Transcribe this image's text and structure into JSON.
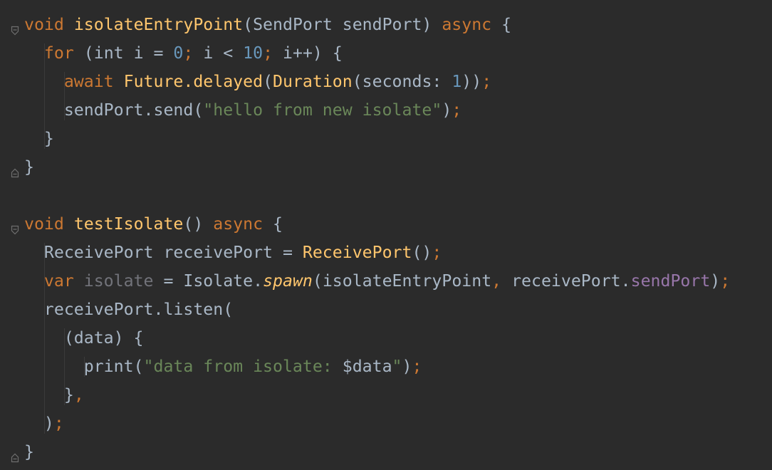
{
  "editor": {
    "theme_colors": {
      "background": "#2b2b2b",
      "default_text": "#a9b7c6",
      "keyword": "#cc7832",
      "function": "#ffc66d",
      "number": "#6897bb",
      "string": "#6a8759",
      "field": "#9876aa",
      "unused": "#72737a"
    },
    "lines": [
      [
        {
          "t": "void ",
          "c": "kw"
        },
        {
          "t": "isolateEntryPoint",
          "c": "fn"
        },
        {
          "t": "(SendPort sendPort) ",
          "c": "plain"
        },
        {
          "t": "async",
          "c": "kw"
        },
        {
          "t": " {",
          "c": "plain"
        }
      ],
      [
        {
          "t": "  ",
          "c": "plain"
        },
        {
          "t": "for",
          "c": "kw"
        },
        {
          "t": " (int i = ",
          "c": "plain"
        },
        {
          "t": "0",
          "c": "num"
        },
        {
          "t": ";",
          "c": "kw"
        },
        {
          "t": " i < ",
          "c": "plain"
        },
        {
          "t": "10",
          "c": "num"
        },
        {
          "t": ";",
          "c": "kw"
        },
        {
          "t": " i++) {",
          "c": "plain"
        }
      ],
      [
        {
          "t": "    ",
          "c": "plain"
        },
        {
          "t": "await ",
          "c": "kw"
        },
        {
          "t": "Future.delayed",
          "c": "fn"
        },
        {
          "t": "(",
          "c": "plain"
        },
        {
          "t": "Duration",
          "c": "fn"
        },
        {
          "t": "(seconds: ",
          "c": "plain"
        },
        {
          "t": "1",
          "c": "num"
        },
        {
          "t": "))",
          "c": "plain"
        },
        {
          "t": ";",
          "c": "kw"
        }
      ],
      [
        {
          "t": "    sendPort.send(",
          "c": "plain"
        },
        {
          "t": "\"hello from new isolate\"",
          "c": "str"
        },
        {
          "t": ")",
          "c": "plain"
        },
        {
          "t": ";",
          "c": "kw"
        }
      ],
      [
        {
          "t": "  }",
          "c": "plain"
        }
      ],
      [
        {
          "t": "}",
          "c": "plain"
        }
      ],
      [],
      [
        {
          "t": "void ",
          "c": "kw"
        },
        {
          "t": "testIsolate",
          "c": "fn"
        },
        {
          "t": "() ",
          "c": "plain"
        },
        {
          "t": "async",
          "c": "kw"
        },
        {
          "t": " {",
          "c": "plain"
        }
      ],
      [
        {
          "t": "  ReceivePort receivePort = ",
          "c": "plain"
        },
        {
          "t": "ReceivePort",
          "c": "fn"
        },
        {
          "t": "()",
          "c": "plain"
        },
        {
          "t": ";",
          "c": "kw"
        }
      ],
      [
        {
          "t": "  ",
          "c": "plain"
        },
        {
          "t": "var ",
          "c": "kw"
        },
        {
          "t": "isolate",
          "c": "unused"
        },
        {
          "t": " = Isolate.",
          "c": "plain"
        },
        {
          "t": "spawn",
          "c": "fn it"
        },
        {
          "t": "(isolateEntryPoint",
          "c": "plain"
        },
        {
          "t": ",",
          "c": "kw"
        },
        {
          "t": " receivePort.",
          "c": "plain"
        },
        {
          "t": "sendPort",
          "c": "fld"
        },
        {
          "t": ")",
          "c": "plain"
        },
        {
          "t": ";",
          "c": "kw"
        }
      ],
      [
        {
          "t": "  receivePort.listen(",
          "c": "plain"
        }
      ],
      [
        {
          "t": "    (data) {",
          "c": "plain"
        }
      ],
      [
        {
          "t": "      print(",
          "c": "plain"
        },
        {
          "t": "\"data from isolate: ",
          "c": "str"
        },
        {
          "t": "$data",
          "c": "plain"
        },
        {
          "t": "\"",
          "c": "str"
        },
        {
          "t": ")",
          "c": "plain"
        },
        {
          "t": ";",
          "c": "kw"
        }
      ],
      [
        {
          "t": "    }",
          "c": "plain"
        },
        {
          "t": ",",
          "c": "kw"
        }
      ],
      [
        {
          "t": "  )",
          "c": "plain"
        },
        {
          "t": ";",
          "c": "kw"
        }
      ],
      [
        {
          "t": "}",
          "c": "plain"
        }
      ]
    ],
    "fold_markers": [
      {
        "line": 0,
        "kind": "open"
      },
      {
        "line": 5,
        "kind": "close"
      },
      {
        "line": 7,
        "kind": "open"
      },
      {
        "line": 15,
        "kind": "close"
      }
    ]
  }
}
